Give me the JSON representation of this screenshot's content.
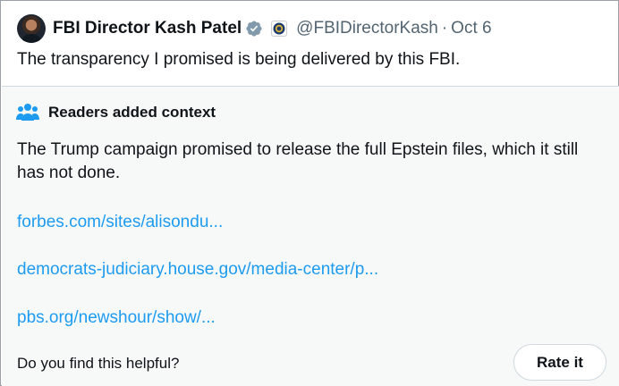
{
  "tweet": {
    "author_name": "FBI Director Kash Patel",
    "handle": "@FBIDirectorKash",
    "separator": "·",
    "date": "Oct 6",
    "text": "The transparency I promised is being delivered by this FBI."
  },
  "note": {
    "title": "Readers added context",
    "body": "The Trump campaign promised to release the full Epstein files, which it still has not done.",
    "links": [
      "forbes.com/sites/alisondu...",
      "democrats-judiciary.house.gov/media-center/p...",
      "pbs.org/newshour/show/..."
    ],
    "prompt": "Do you find this helpful?",
    "rate_label": "Rate it"
  },
  "icons": {
    "verified": "verified-badge-icon",
    "org": "fbi-seal-icon",
    "note": "people-icon"
  },
  "colors": {
    "link": "#1d9bf0",
    "secondary_text": "#536471",
    "note_background": "#f7f9f9"
  }
}
